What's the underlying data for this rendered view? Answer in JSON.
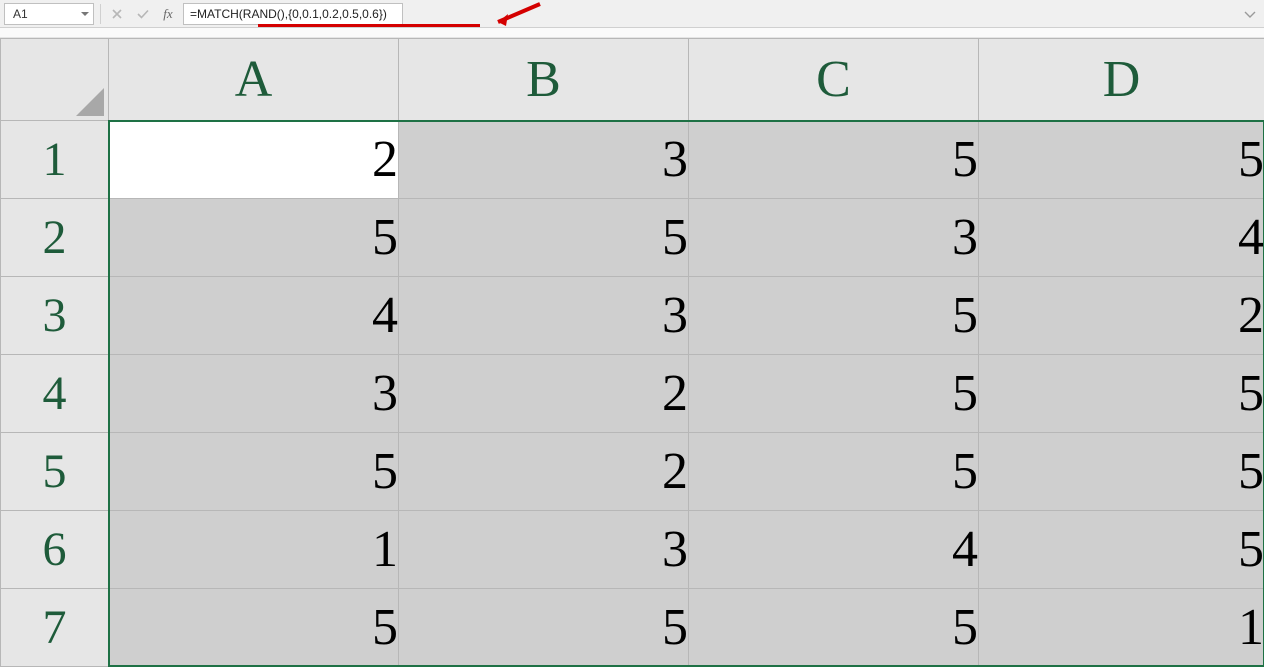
{
  "name_box": {
    "value": "A1"
  },
  "formula_bar": {
    "fx_label": "fx",
    "buttons": {
      "cancel_icon": "cancel-icon",
      "enter_icon": "enter-icon"
    },
    "formula": "=MATCH(RAND(),{0,0.1,0.2,0.5,0.6})"
  },
  "columns": [
    "A",
    "B",
    "C",
    "D"
  ],
  "rows": [
    "1",
    "2",
    "3",
    "4",
    "5",
    "6",
    "7"
  ],
  "chart_data": {
    "type": "table",
    "columns": [
      "A",
      "B",
      "C",
      "D"
    ],
    "rows": [
      "1",
      "2",
      "3",
      "4",
      "5",
      "6",
      "7"
    ],
    "values": [
      [
        2,
        3,
        5,
        5
      ],
      [
        5,
        5,
        3,
        4
      ],
      [
        4,
        3,
        5,
        2
      ],
      [
        3,
        2,
        5,
        5
      ],
      [
        5,
        2,
        5,
        5
      ],
      [
        1,
        3,
        4,
        5
      ],
      [
        5,
        5,
        5,
        1
      ]
    ]
  },
  "active_cell": "A1",
  "selection": "A1:D7"
}
